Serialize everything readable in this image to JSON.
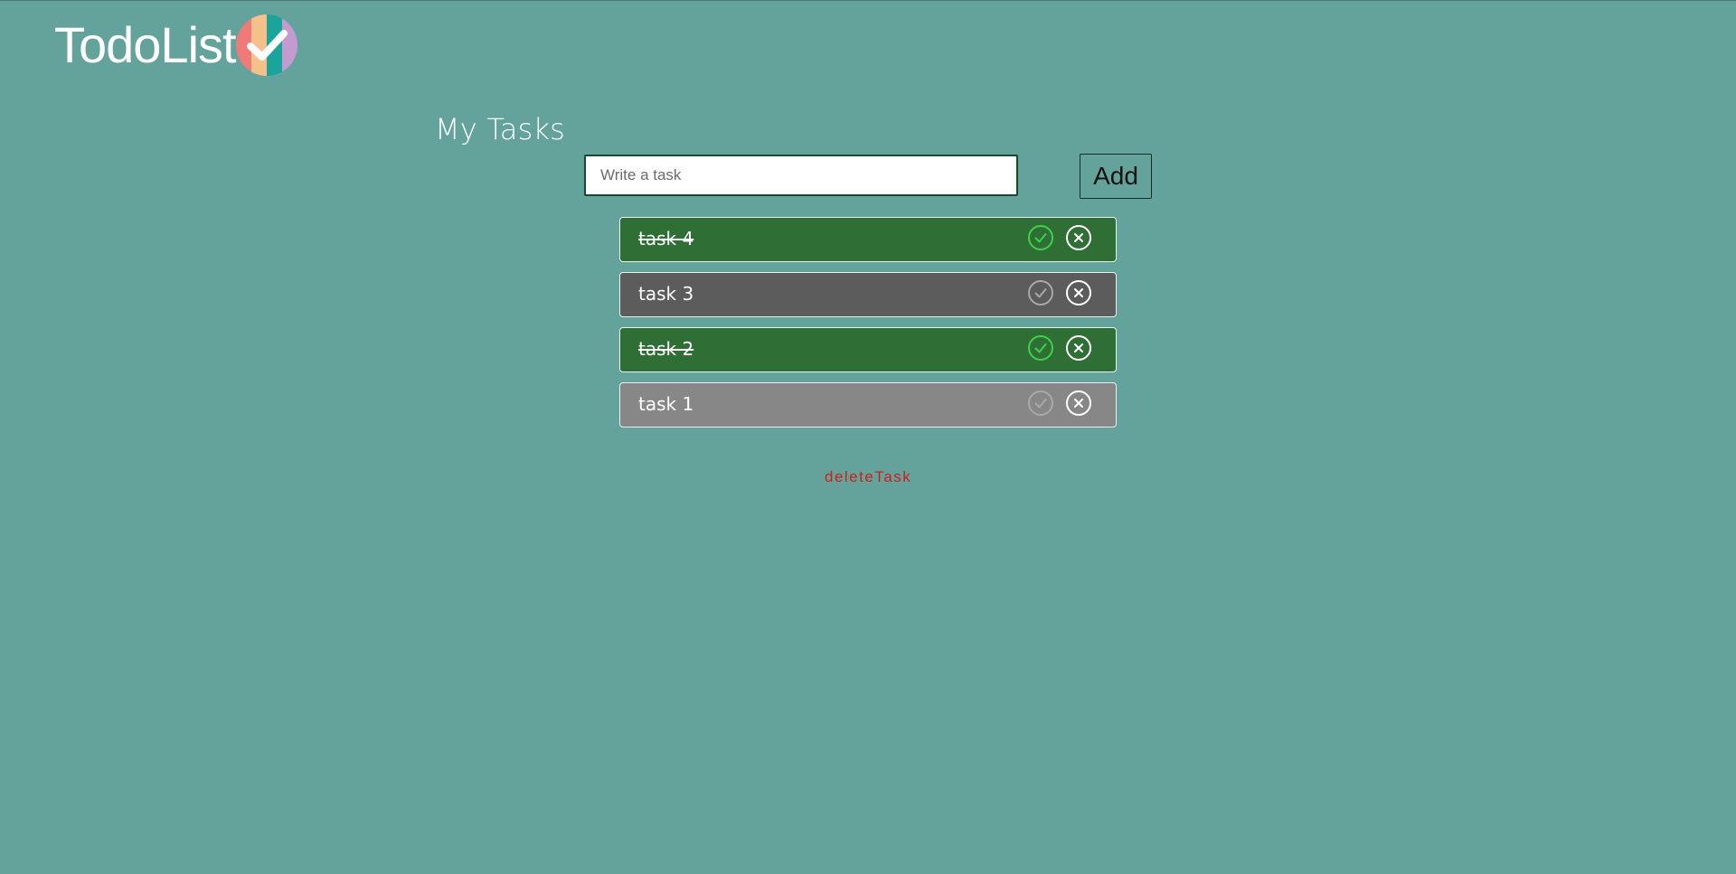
{
  "app": {
    "logo_text": "TodoList",
    "logo_icon": "checkmark-badge-icon"
  },
  "header": {
    "title": "My Tasks"
  },
  "input": {
    "placeholder": "Write a task",
    "value": "",
    "add_label": "Add"
  },
  "tasks": [
    {
      "label": "task 4",
      "completed": true,
      "style": "done"
    },
    {
      "label": "task 3",
      "completed": false,
      "style": "dark"
    },
    {
      "label": "task 2",
      "completed": true,
      "style": "done"
    },
    {
      "label": "task 1",
      "completed": false,
      "style": "light"
    }
  ],
  "footer": {
    "label": "deleteTask"
  },
  "colors": {
    "background": "#64a39c",
    "done": "#2f6e34",
    "pending_dark": "#5c5c5c",
    "pending_light": "#878787",
    "check_active": "#3ed14a",
    "check_inactive": "#a8a8a8",
    "footer_text": "#d21d1d"
  }
}
